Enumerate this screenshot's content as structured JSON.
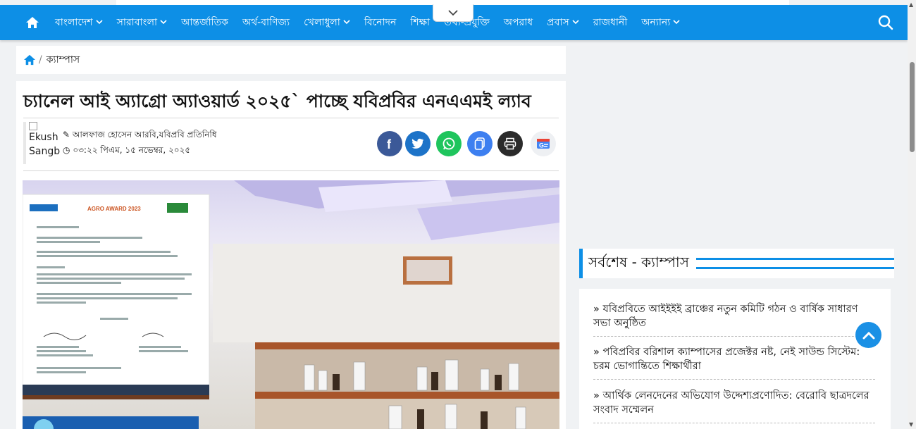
{
  "nav": {
    "items": [
      {
        "label": "বাংলাদেশ",
        "has_dropdown": true
      },
      {
        "label": "সারাবাংলা",
        "has_dropdown": true
      },
      {
        "label": "আন্তর্জাতিক",
        "has_dropdown": false
      },
      {
        "label": "অর্থ-বাণিজ্য",
        "has_dropdown": false
      },
      {
        "label": "খেলাধুলা",
        "has_dropdown": true
      },
      {
        "label": "বিনোদন",
        "has_dropdown": false
      },
      {
        "label": "শিক্ষা",
        "has_dropdown": false
      },
      {
        "label": "তথ্য-প্রযুক্তি",
        "has_dropdown": false
      },
      {
        "label": "অপরাধ",
        "has_dropdown": false
      },
      {
        "label": "প্রবাস",
        "has_dropdown": true
      },
      {
        "label": "রাজধানী",
        "has_dropdown": false
      },
      {
        "label": "অন্যান্য",
        "has_dropdown": true
      }
    ],
    "chevron": "⌄"
  },
  "breadcrumb": {
    "current": "ক্যাম্পাস",
    "separator": "/"
  },
  "article": {
    "headline": "চ্যানেল আই অ্যাগ্রো অ্যাওয়ার্ড ২০২৫` পাচ্ছে যবিপ্রবির এনএএমই ল্যাব",
    "author_img_alt_1": "Ekush",
    "author_img_alt_2": "Sangb",
    "author": "আলফাজ হোসেন আরবি,যবিপ্রবি প্রতিনিধি",
    "published": "০৩:২২ পিএম, ১৫ নভেম্বর, ২০২৫",
    "photo_doc_header": "AGRO AWARD 2023"
  },
  "sidebar": {
    "latest_title": "সর্বশেষ - ক্যাম্পাস",
    "bullet": "»",
    "items": [
      "যবিপ্রবিতে আইইইই ব্রাঞ্চের নতুন কমিটি গঠন ও বার্ষিক সাধারণ সভা অনুষ্ঠিত",
      "পবিপ্রবির বরিশাল ক্যাম্পাসের প্রজেক্টর নষ্ট, নেই সাউন্ড সিস্টেম: চরম ভোগান্তিতে শিক্ষার্থীরা",
      "আর্থিক লেনদেনের অভিযোগ উদ্দেশ্যপ্রণোদিত: বেরোবি ছাত্রদলের সংবাদ সম্মেলন"
    ]
  },
  "colors": {
    "brand": "#0d8fe6",
    "facebook": "#3b5998",
    "twitter": "#1d73c8",
    "whatsapp": "#1fc55d",
    "copy": "#3d7ff0",
    "print": "#2b2b2b"
  }
}
